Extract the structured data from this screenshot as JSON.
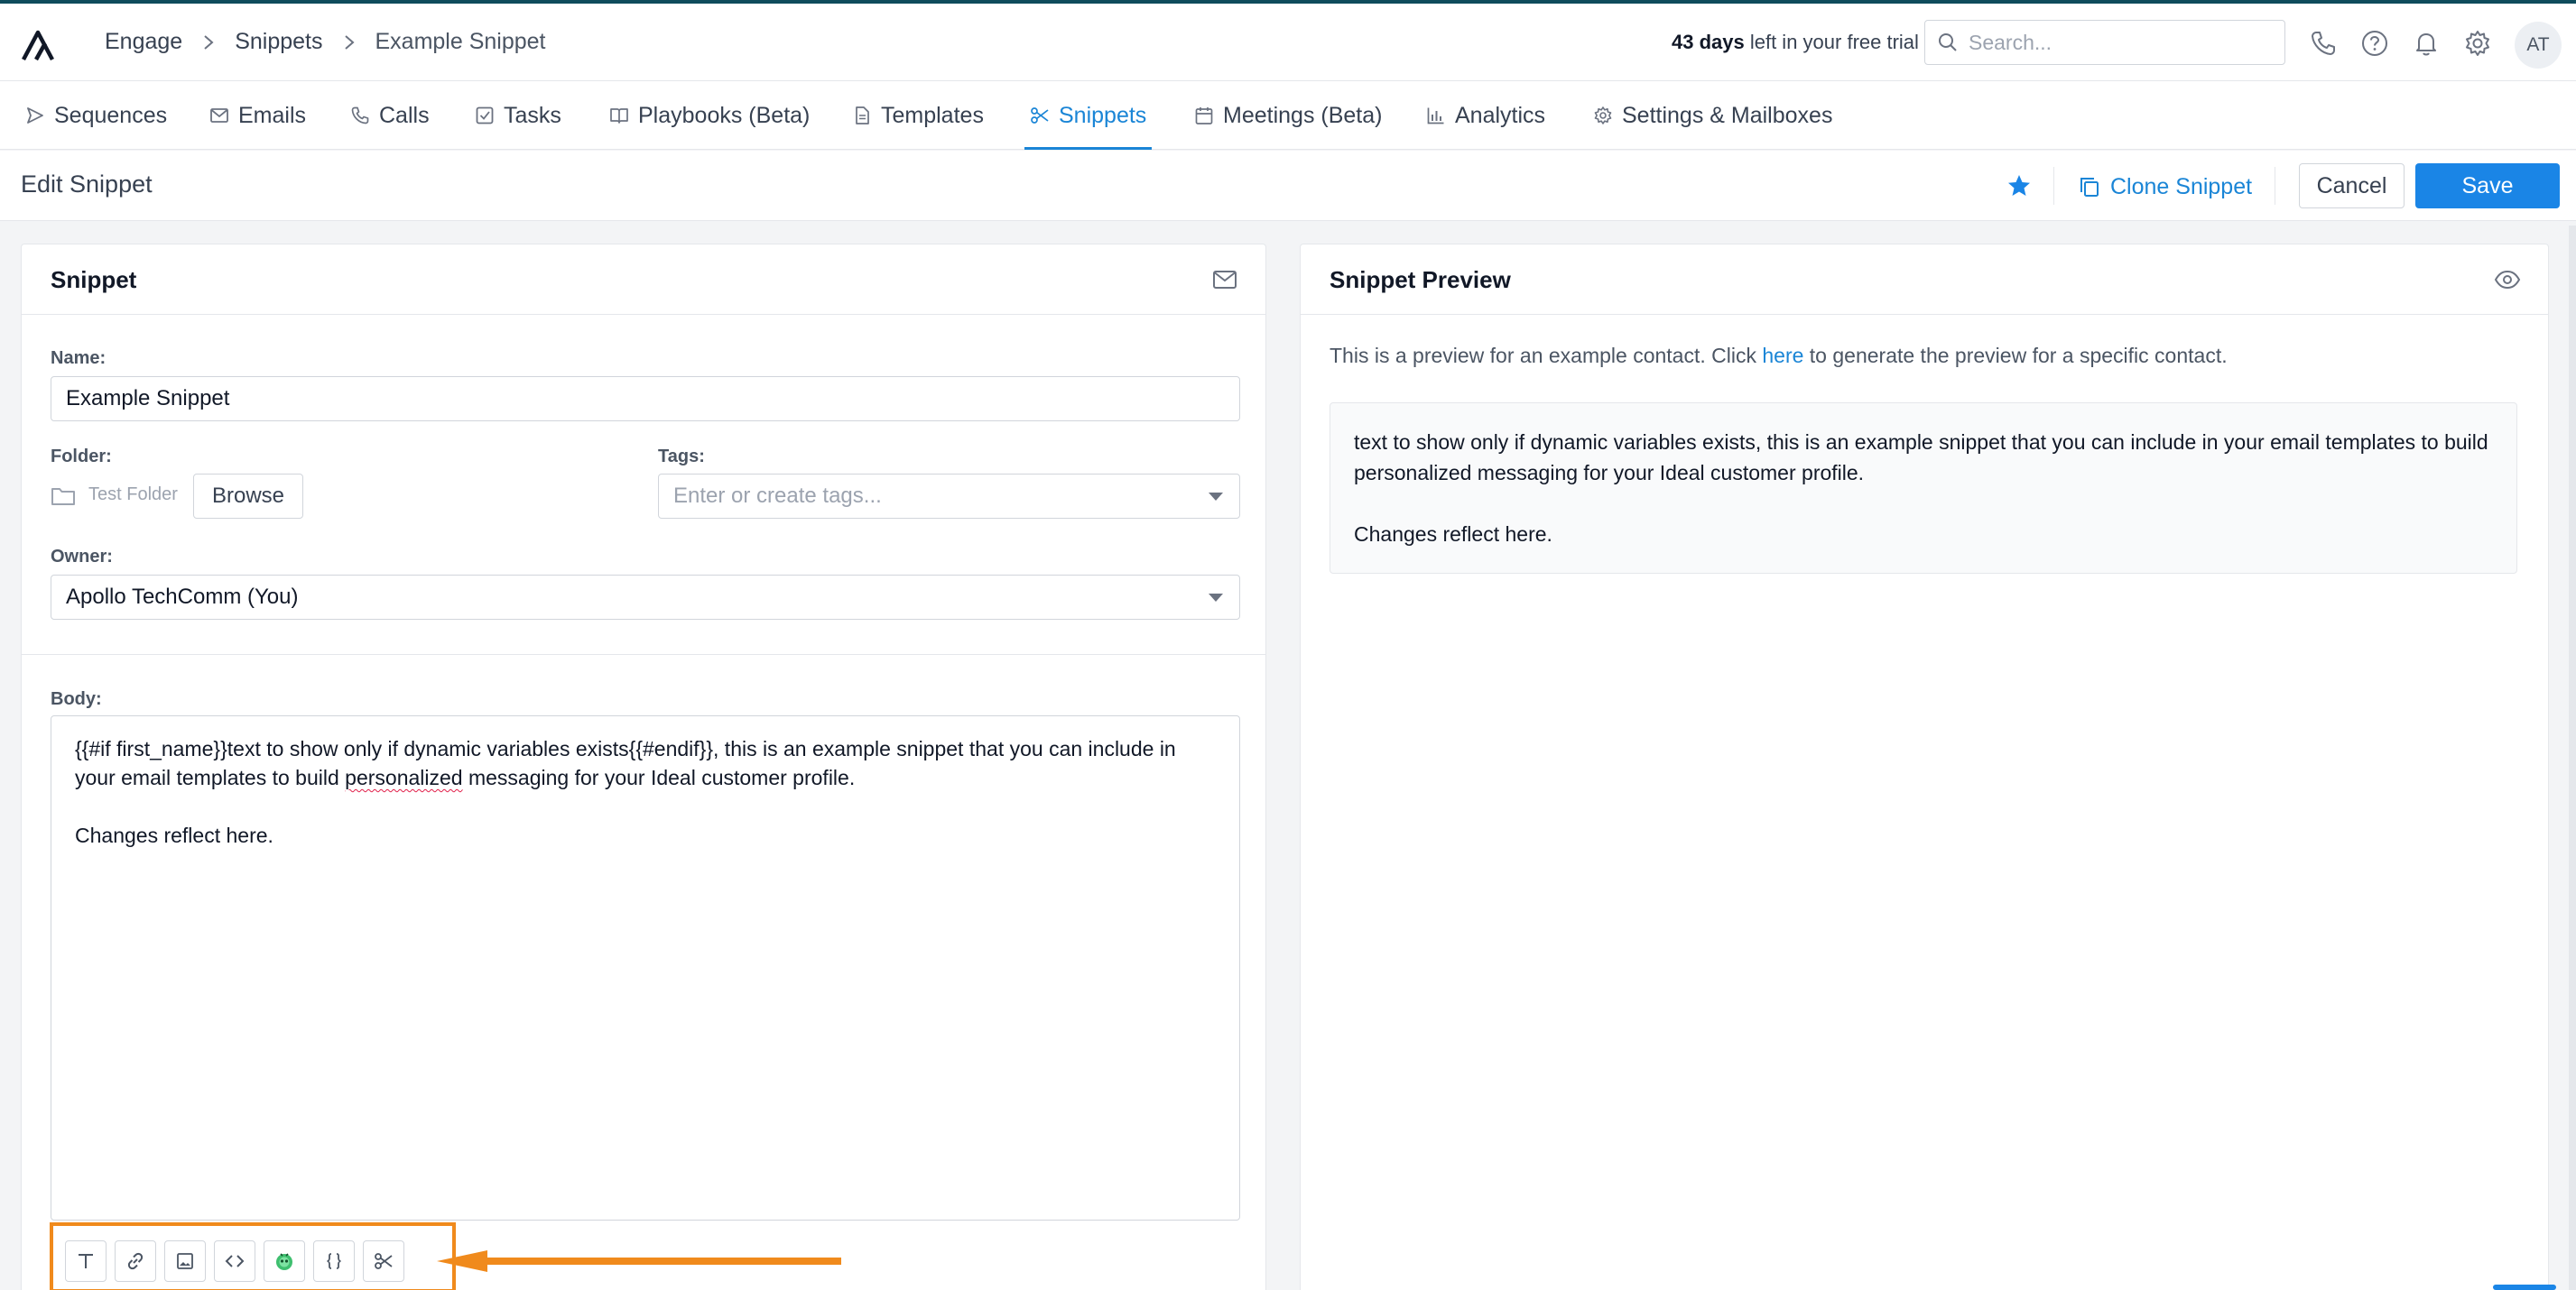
{
  "topbar": {
    "breadcrumbs": [
      "Engage",
      "Snippets",
      "Example Snippet"
    ],
    "trial_bold": "43 days",
    "trial_rest": " left in your free trial",
    "search_placeholder": "Search...",
    "avatar_initials": "AT"
  },
  "nav": {
    "items": [
      {
        "label": "Sequences",
        "icon": "send-icon"
      },
      {
        "label": "Emails",
        "icon": "mail-icon"
      },
      {
        "label": "Calls",
        "icon": "phone-icon"
      },
      {
        "label": "Tasks",
        "icon": "checkbox-icon"
      },
      {
        "label": "Playbooks (Beta)",
        "icon": "book-icon"
      },
      {
        "label": "Templates",
        "icon": "document-icon"
      },
      {
        "label": "Snippets",
        "icon": "scissors-icon"
      },
      {
        "label": "Meetings (Beta)",
        "icon": "calendar-icon"
      },
      {
        "label": "Analytics",
        "icon": "bar-chart-icon"
      },
      {
        "label": "Settings & Mailboxes",
        "icon": "gear-icon"
      }
    ],
    "active": "Snippets"
  },
  "editbar": {
    "title": "Edit Snippet",
    "clone_label": "Clone Snippet",
    "cancel_label": "Cancel",
    "save_label": "Save"
  },
  "snippet_form": {
    "title": "Snippet",
    "name_label": "Name:",
    "name_value": "Example Snippet",
    "folder_label": "Folder:",
    "folder_name": "Test Folder",
    "browse_label": "Browse",
    "tags_label": "Tags:",
    "tags_placeholder": "Enter or create tags...",
    "owner_label": "Owner:",
    "owner_value": "Apollo TechComm (You)",
    "body_label": "Body:",
    "body_line1_a": "{{#if first_name}}text to show only if dynamic variables exists{{#endif}}, this is an example snippet that you can include in your email templates to build ",
    "body_line1_misspelled": "personalized",
    "body_line1_b": " messaging for your Ideal customer profile.",
    "body_line2": "Changes reflect here.",
    "toolbar_icons": [
      "text-format-icon",
      "link-icon",
      "image-icon",
      "code-icon",
      "ai-assistant-icon",
      "variable-braces-icon",
      "snippet-scissors-icon"
    ],
    "highlight_color": "#f08a1c"
  },
  "preview": {
    "title": "Snippet Preview",
    "note_a": "This is a preview for an example contact. Click ",
    "note_link": "here",
    "note_b": " to generate the preview for a specific contact.",
    "text_line1": "text to show only if dynamic variables exists, this is an example snippet that you can include in your email templates to build personalized messaging for your Ideal customer profile.",
    "text_line2": "Changes reflect here."
  },
  "colors": {
    "accent": "#1a85d6",
    "brand_top_border": "#0f4c5c",
    "annotation_orange": "#f08a1c"
  }
}
